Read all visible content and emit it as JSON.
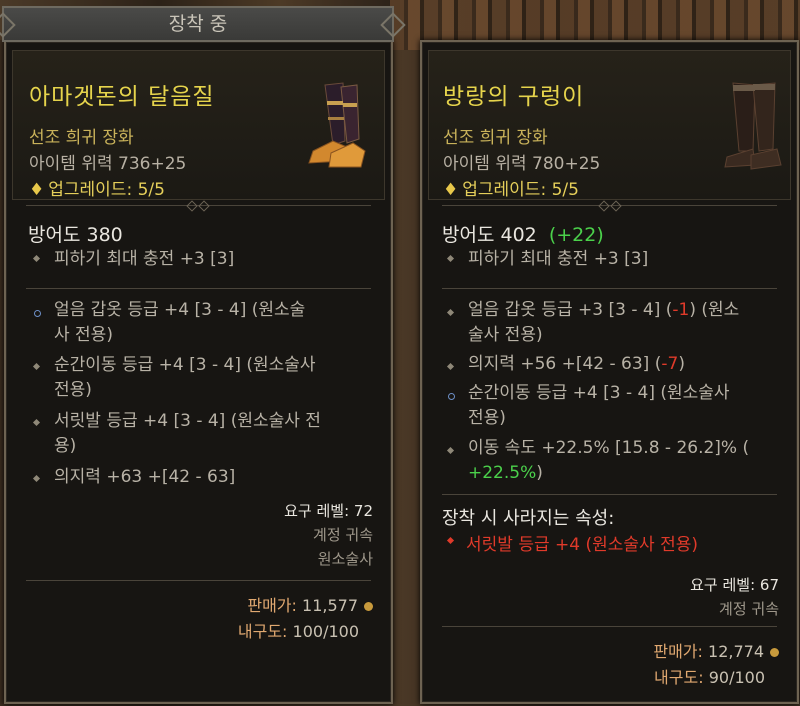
{
  "equipped_label": "장착 중",
  "left": {
    "name": "아마겟돈의 달음질",
    "rarity": "선조 희귀 장화",
    "item_power": "아이템 위력 736+25",
    "upgrade": "업그레이드: 5/5",
    "armor": "방어도 380",
    "implicit": "피하기 최대 충전 +3 [3]",
    "affixes": [
      {
        "l1": "얼음 갑옷 등급 +4 [3 - 4] (원소술",
        "l2": "사 전용)"
      },
      {
        "l1": "순간이동 등급 +4 [3 - 4] (원소술사",
        "l2": "전용)"
      },
      {
        "l1": "서릿발 등급 +4 [3 - 4] (원소술사 전",
        "l2": "용)"
      },
      {
        "l1": "의지력 +63 +[42 - 63]",
        "l2": ""
      }
    ],
    "req_level": "요구 레벨: 72",
    "account_bound": "계정 귀속",
    "class": "원소술사",
    "sell_label": "판매가:",
    "sell_value": "11,577",
    "durability_label": "내구도:",
    "durability_value": "100/100"
  },
  "right": {
    "name": "방랑의 구렁이",
    "rarity": "선조 희귀 장화",
    "item_power": "아이템 위력 780+25",
    "upgrade": "업그레이드: 5/5",
    "armor": "방어도 402",
    "armor_delta": "(+22)",
    "implicit": "피하기 최대 충전 +3 [3]",
    "affix1_a": "얼음 갑옷 등급 +3 [3 - 4] (",
    "affix1_neg": "-1",
    "affix1_b": ") (원소",
    "affix1_l2": "술사 전용)",
    "affix2_a": "의지력 +56 +[42 - 63] (",
    "affix2_neg": "-7",
    "affix2_b": ")",
    "affix3_l1": "순간이동 등급 +4 [3 - 4] (원소술사",
    "affix3_l2": "전용)",
    "affix4_l1": "이동 속도 +22.5% [15.8 - 26.2]% (",
    "affix4_pos": "+22.5%",
    "affix4_b": ")",
    "lose_title": "장착 시 사라지는 속성:",
    "lose_item": "서릿발 등급 +4 (원소술사 전용)",
    "req_level": "요구 레벨: 67",
    "account_bound": "계정 귀속",
    "sell_label": "판매가:",
    "sell_value": "12,774",
    "durability_label": "내구도:",
    "durability_value": "90/100"
  },
  "colors": {
    "legendary_title": "#e6d44c",
    "negative": "#e03a2a",
    "positive": "#4bd14b"
  }
}
